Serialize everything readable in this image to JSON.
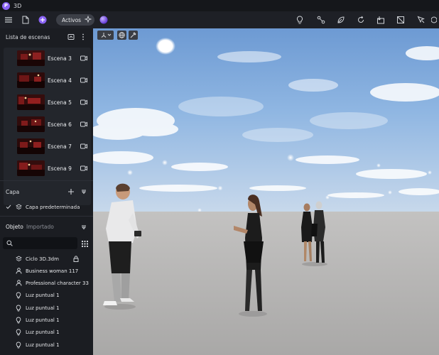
{
  "app": {
    "title": "3D",
    "logo_letter": "P"
  },
  "toolbar": {
    "active_label": "Activos",
    "left_icons": [
      "menu-icon",
      "new-file-icon",
      "add-icon",
      "sparkle-icon",
      "orb-icon"
    ],
    "right_icons": [
      "light-bulb-icon",
      "node-link-icon",
      "leaf-icon",
      "refresh-icon",
      "import-icon",
      "no-image-icon",
      "cursor-icon"
    ],
    "accent": "#8a63f5"
  },
  "scenes": {
    "title": "Lista de escenas",
    "items": [
      {
        "label": "Escena 3"
      },
      {
        "label": "Escena 4"
      },
      {
        "label": "Escena 5"
      },
      {
        "label": "Escena 6"
      },
      {
        "label": "Escena 7"
      },
      {
        "label": "Escena 9"
      }
    ]
  },
  "layers": {
    "title": "Capa",
    "items": [
      {
        "label": "Capa predeterminada",
        "checked": true
      }
    ]
  },
  "objects": {
    "tab_active": "Objeto",
    "tab_inactive": "Importado",
    "search_placeholder": "",
    "items": [
      {
        "label": "Ciclo 3D.3dm",
        "icon": "layers-icon",
        "locked": true
      },
      {
        "label": "Business woman 117",
        "icon": "person-icon"
      },
      {
        "label": "Professional character 33",
        "icon": "person-icon"
      },
      {
        "label": "Luz puntual 1",
        "icon": "bulb-icon"
      },
      {
        "label": "Luz puntual 1",
        "icon": "bulb-icon"
      },
      {
        "label": "Luz puntual 1",
        "icon": "bulb-icon"
      },
      {
        "label": "Luz puntual 1",
        "icon": "bulb-icon"
      },
      {
        "label": "Luz puntual 1",
        "icon": "bulb-icon"
      }
    ]
  }
}
